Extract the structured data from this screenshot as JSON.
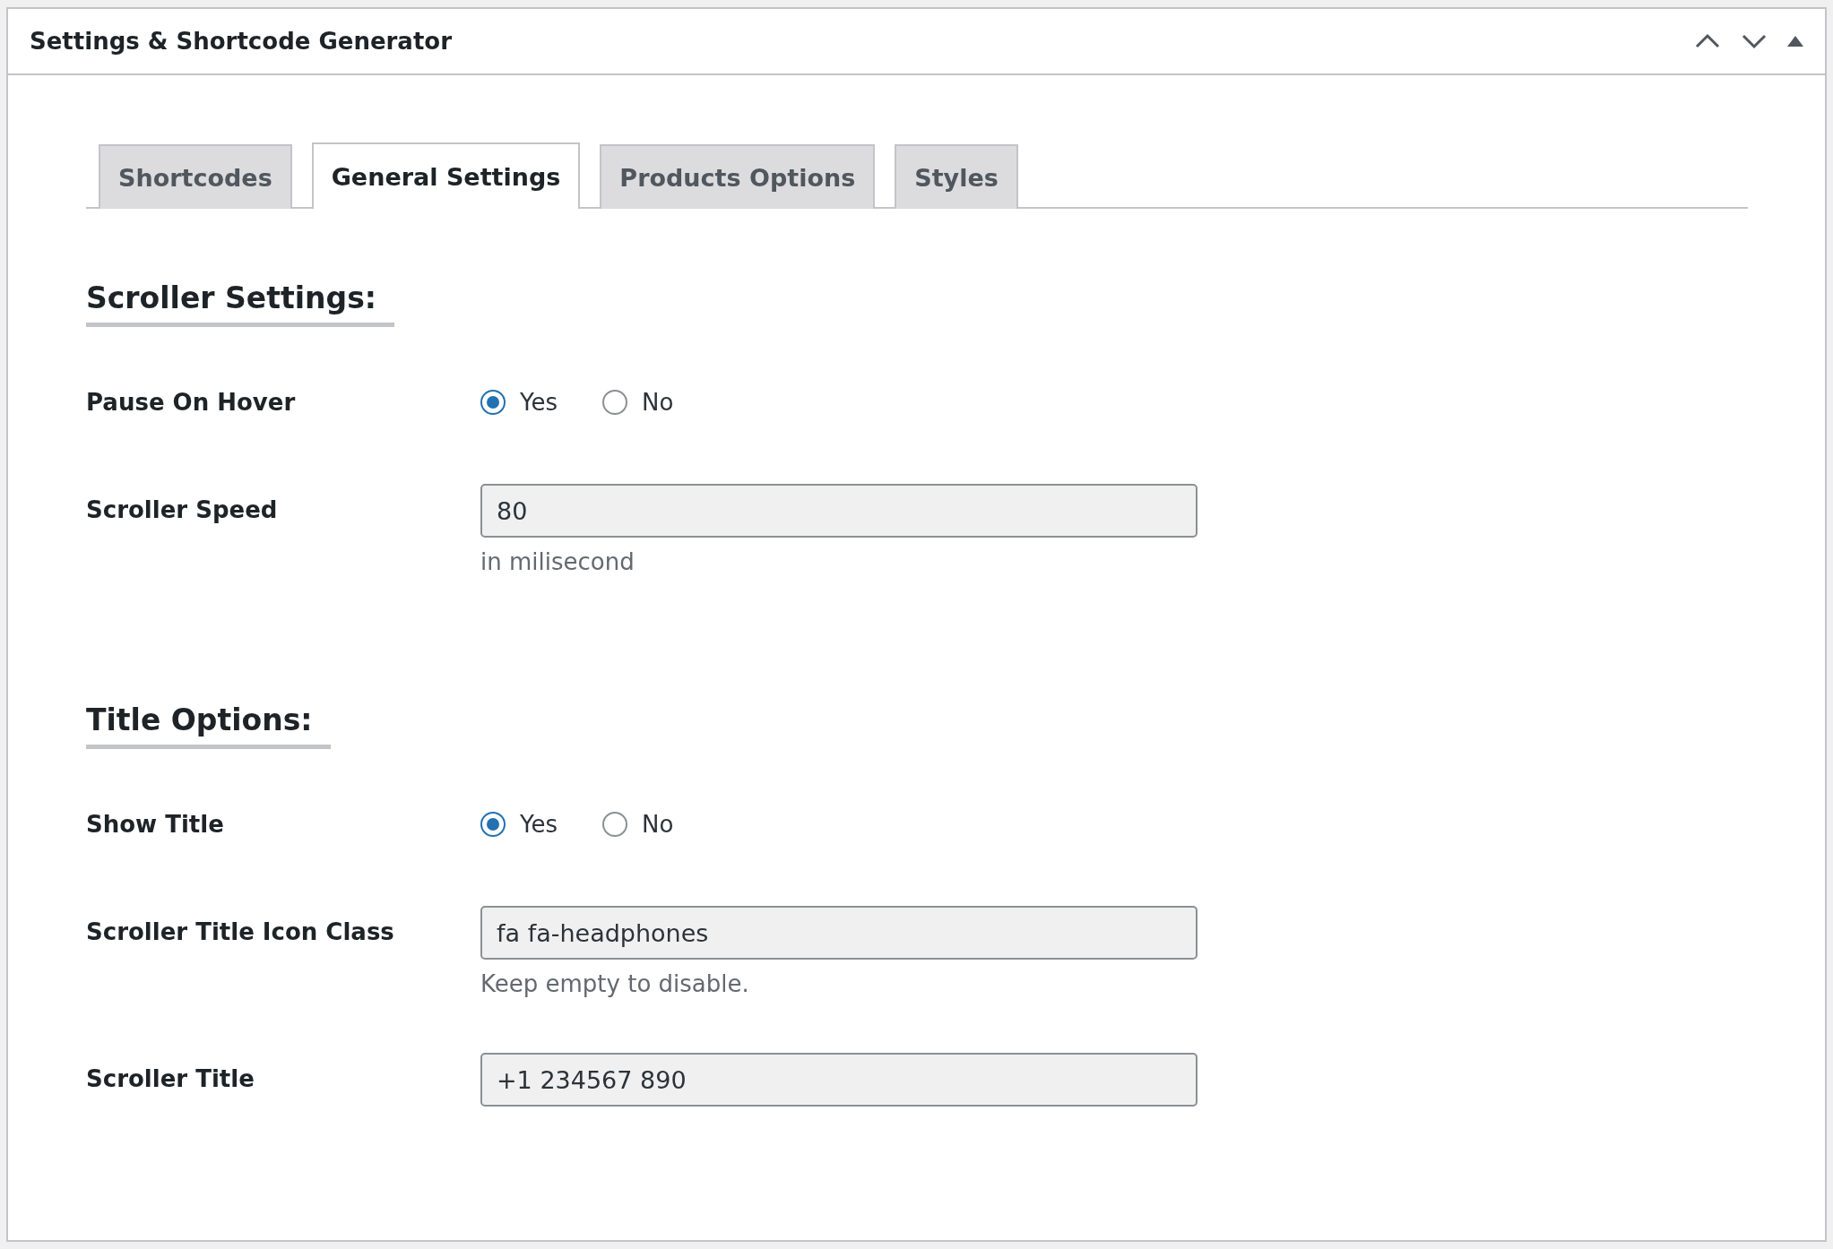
{
  "panel": {
    "title": "Settings & Shortcode Generator"
  },
  "tabs": [
    {
      "label": "Shortcodes",
      "selected": false
    },
    {
      "label": "General Settings",
      "selected": true
    },
    {
      "label": "Products Options",
      "selected": false
    },
    {
      "label": "Styles",
      "selected": false
    }
  ],
  "sections": [
    {
      "heading": "Scroller Settings:",
      "rows": [
        {
          "kind": "radio",
          "label": "Pause On Hover",
          "options": [
            {
              "label": "Yes",
              "selected": true
            },
            {
              "label": "No",
              "selected": false
            }
          ]
        },
        {
          "kind": "text",
          "label": "Scroller Speed",
          "value": "80",
          "hint": "in milisecond"
        }
      ]
    },
    {
      "heading": "Title Options:",
      "rows": [
        {
          "kind": "radio",
          "label": "Show Title",
          "options": [
            {
              "label": "Yes",
              "selected": true
            },
            {
              "label": "No",
              "selected": false
            }
          ]
        },
        {
          "kind": "text",
          "label": "Scroller Title Icon Class",
          "value": "fa fa-headphones",
          "hint": "Keep empty to disable."
        },
        {
          "kind": "text",
          "label": "Scroller Title",
          "value": "+1 234567 890"
        }
      ]
    }
  ]
}
